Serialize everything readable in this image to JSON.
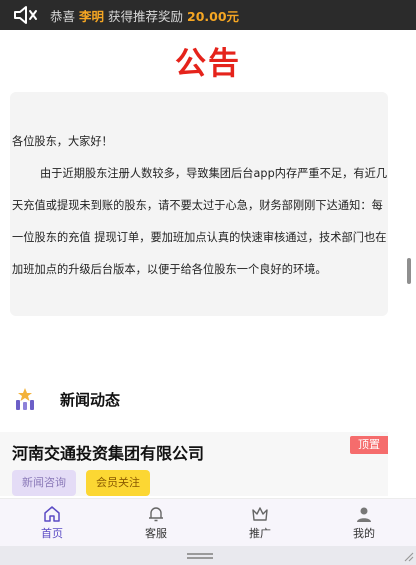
{
  "marquee": {
    "prefix": "恭喜",
    "user": "李明",
    "middle": "获得推荐奖励",
    "amount": "20.00元"
  },
  "notice": {
    "title": "公告",
    "greeting": "各位股东，大家好！",
    "body": "由于近期股东注册人数较多，导致集团后台app内存严重不足，有近几天充值或提现未到账的股东，请不要太过于心急，财务部刚刚下达通知：每一位股东的充值 提现订单，要加班加点认真的快速审核通过，技术部门也在加班加点的升级后台版本，以便于给各位股东一个良好的环境。"
  },
  "news": {
    "heading": "新闻动态",
    "card": {
      "company": "河南交通投资集团有限公司",
      "pin": "顶置",
      "tag1": "新闻咨询",
      "tag2": "会员关注"
    }
  },
  "nav": {
    "items": [
      {
        "label": "首页",
        "icon": "home-icon",
        "active": true
      },
      {
        "label": "客服",
        "icon": "bell-icon"
      },
      {
        "label": "推广",
        "icon": "crown-icon"
      },
      {
        "label": "我的",
        "icon": "user-icon"
      }
    ]
  },
  "colors": {
    "accent": "#5b4bc4",
    "title_red": "#e5231b",
    "highlight": "#f5a623"
  }
}
